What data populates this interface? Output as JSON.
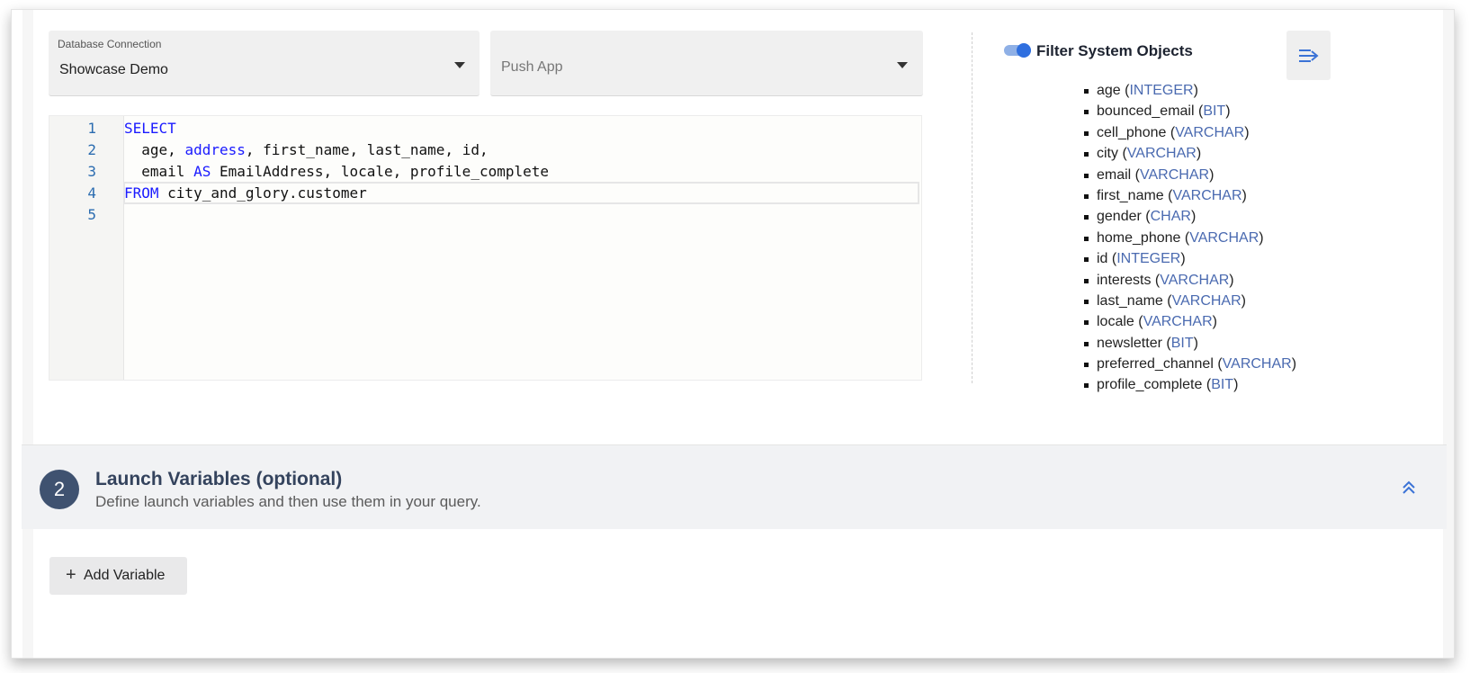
{
  "connection": {
    "label": "Database Connection",
    "value": "Showcase Demo"
  },
  "push_app": {
    "placeholder": "Push App"
  },
  "editor": {
    "lines": [
      {
        "number": "1",
        "tokens": [
          {
            "text": "SELECT",
            "kind": "kw"
          }
        ]
      },
      {
        "number": "2",
        "tokens": [
          {
            "text": "  age, ",
            "kind": "plain"
          },
          {
            "text": "address",
            "kind": "kw"
          },
          {
            "text": ", first_name, last_name, id,",
            "kind": "plain"
          }
        ]
      },
      {
        "number": "3",
        "tokens": [
          {
            "text": "  email ",
            "kind": "plain"
          },
          {
            "text": "AS",
            "kind": "kw"
          },
          {
            "text": " EmailAddress, locale, profile_complete",
            "kind": "plain"
          }
        ]
      },
      {
        "number": "4",
        "tokens": [
          {
            "text": "FROM",
            "kind": "kw"
          },
          {
            "text": " city_and_glory.customer",
            "kind": "plain"
          }
        ]
      },
      {
        "number": "5",
        "tokens": []
      }
    ]
  },
  "schema": {
    "filter_label": "Filter System Objects",
    "filter_enabled": true,
    "columns": [
      {
        "name": "age",
        "type": "INTEGER"
      },
      {
        "name": "bounced_email",
        "type": "BIT"
      },
      {
        "name": "cell_phone",
        "type": "VARCHAR"
      },
      {
        "name": "city",
        "type": "VARCHAR"
      },
      {
        "name": "email",
        "type": "VARCHAR"
      },
      {
        "name": "first_name",
        "type": "VARCHAR"
      },
      {
        "name": "gender",
        "type": "CHAR"
      },
      {
        "name": "home_phone",
        "type": "VARCHAR"
      },
      {
        "name": "id",
        "type": "INTEGER"
      },
      {
        "name": "interests",
        "type": "VARCHAR"
      },
      {
        "name": "last_name",
        "type": "VARCHAR"
      },
      {
        "name": "locale",
        "type": "VARCHAR"
      },
      {
        "name": "newsletter",
        "type": "BIT"
      },
      {
        "name": "preferred_channel",
        "type": "VARCHAR"
      },
      {
        "name": "profile_complete",
        "type": "BIT"
      }
    ]
  },
  "section2": {
    "step": "2",
    "title": "Launch Variables (optional)",
    "subtitle": "Define launch variables and then use them in your query."
  },
  "add_variable": {
    "label": "Add Variable",
    "icon": "plus-icon"
  },
  "icons": {
    "collapse_panel": "collapse-right-icon",
    "section_toggle": "chevron-double-up-icon",
    "dropdown": "caret-down-icon"
  },
  "colors": {
    "accent": "#2f6fdf",
    "keyword": "#1a1aff",
    "type": "#4a6ab0",
    "step_circle": "#3f5270"
  }
}
